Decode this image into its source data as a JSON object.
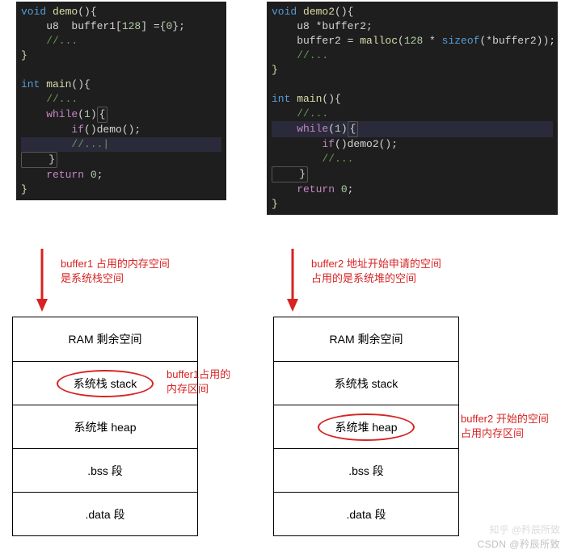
{
  "leftCode": {
    "l1a": "void",
    "l1b": " demo",
    "l1c": "(){",
    "l2a": "    u8  buffer1[",
    "l2b": "128",
    "l2c": "] ={",
    "l2d": "0",
    "l2e": "};",
    "l3": "    //...",
    "l4": "}",
    "l5": "",
    "l6a": "int",
    "l6b": " main",
    "l6c": "(){",
    "l7": "    //...",
    "l8a": "    while",
    "l8b": "(",
    "l8c": "1",
    "l8d": ")",
    "l8e": "{",
    "l9a": "        if",
    "l9b": "()demo();",
    "l10": "        //...|",
    "l11": "    }",
    "l12a": "    return ",
    "l12b": "0",
    "l12c": ";",
    "l13": "}"
  },
  "rightCode": {
    "l1a": "void",
    "l1b": " demo2",
    "l1c": "(){",
    "l2": "    u8 *buffer2;",
    "l3a": "    buffer2 = ",
    "l3b": "malloc",
    "l3c": "(",
    "l3d": "128",
    "l3e": " * ",
    "l3f": "sizeof",
    "l3g": "(*buffer2));",
    "l4": "    //...",
    "l5": "}",
    "l6": "",
    "l7a": "int",
    "l7b": " main",
    "l7c": "(){",
    "l8": "    //...",
    "l9a": "    while",
    "l9b": "(",
    "l9c": "1",
    "l9d": ")",
    "l9e": "{",
    "l10a": "        if",
    "l10b": "()demo2();",
    "l11": "        //...",
    "l12": "    }",
    "l13a": "    return ",
    "l13b": "0",
    "l13c": ";",
    "l14": "}"
  },
  "notes": {
    "leftNote1": "buffer1 占用的内存空间",
    "leftNote2": "是系统栈空间",
    "rightNote1": "buffer2 地址开始申请的空间",
    "rightNote2": "占用的是系统堆的空间",
    "stackNote1": "buffer1占用的",
    "stackNote2": "内存区间",
    "heapNote1": "buffer2 开始的空间",
    "heapNote2": "占用内存区间"
  },
  "mem": {
    "r1": "RAM 剩余空间",
    "r2": "系统栈 stack",
    "r3": "系统堆 heap",
    "r4": ".bss 段",
    "r5": ".data 段"
  },
  "watermark": "CSDN @矜辰所致",
  "watermark2": "知乎 @矜辰所致"
}
